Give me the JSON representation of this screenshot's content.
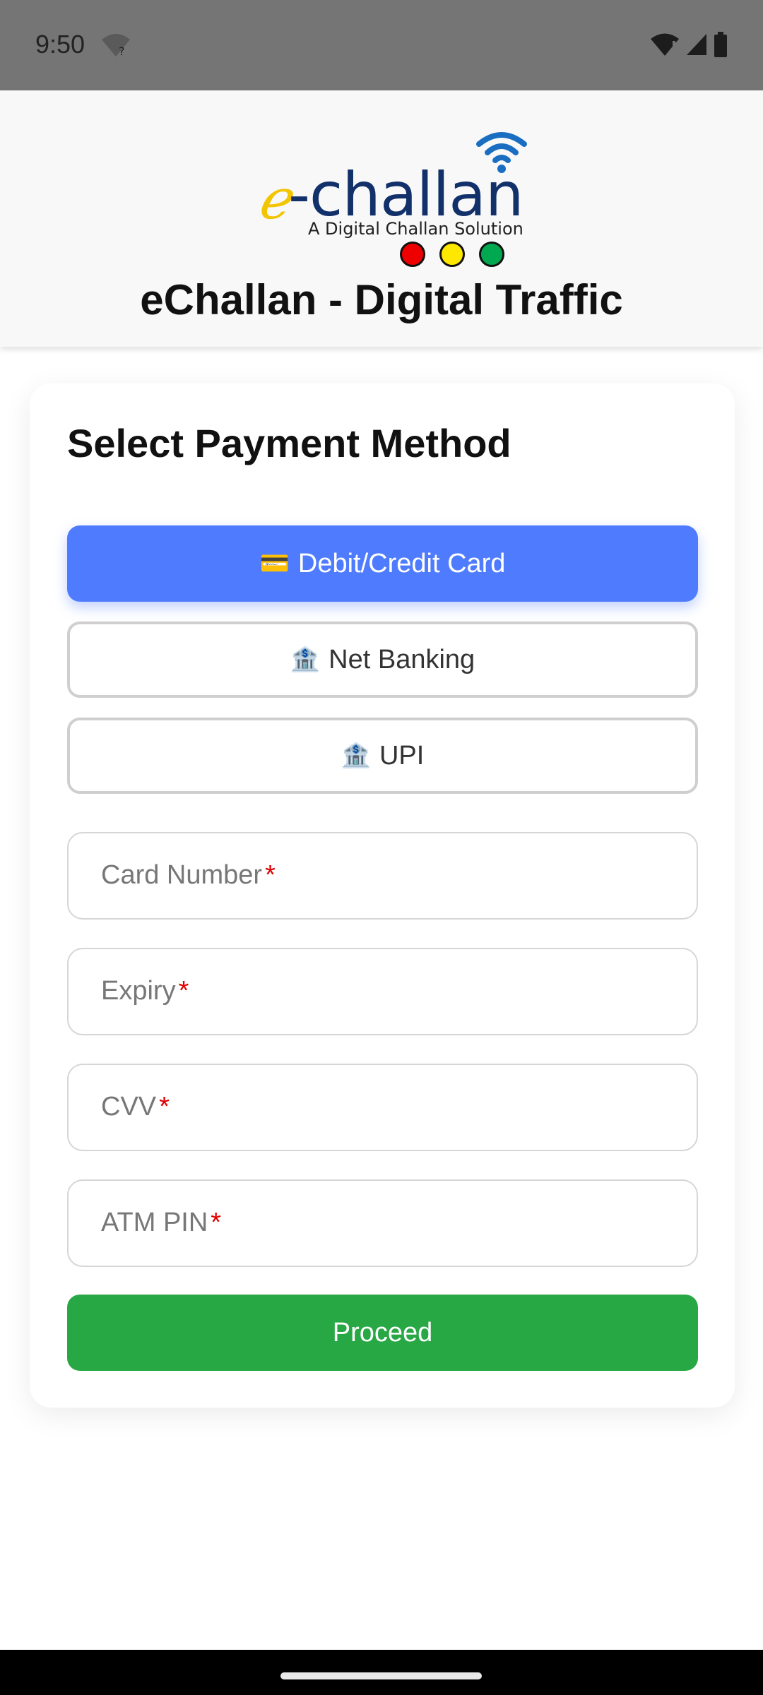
{
  "status_bar": {
    "time": "9:50",
    "icons": [
      "wifi-question-icon",
      "wifi-alert-icon",
      "cell-signal-icon",
      "battery-icon"
    ]
  },
  "header": {
    "logo": {
      "text": "e-challan",
      "tagline": "A Digital Challan Solution",
      "traffic_dot_colors": [
        "#ee0000",
        "#ffe800",
        "#00a84f"
      ]
    },
    "title": "eChallan - Digital Traffic"
  },
  "payment": {
    "title": "Select Payment Method",
    "methods": [
      {
        "emoji": "💳",
        "label": "Debit/Credit Card",
        "active": true
      },
      {
        "emoji": "🏦",
        "label": "Net Banking",
        "active": false
      },
      {
        "emoji": "🏦",
        "label": "UPI",
        "active": false
      }
    ],
    "fields": [
      {
        "label": "Card Number",
        "required_mark": "*"
      },
      {
        "label": "Expiry",
        "required_mark": "*"
      },
      {
        "label": "CVV",
        "required_mark": "*"
      },
      {
        "label": "ATM PIN",
        "required_mark": "*"
      }
    ],
    "proceed_label": "Proceed"
  },
  "colors": {
    "accent": "#4f7cff",
    "proceed": "#28a745",
    "required": "#e00000"
  }
}
